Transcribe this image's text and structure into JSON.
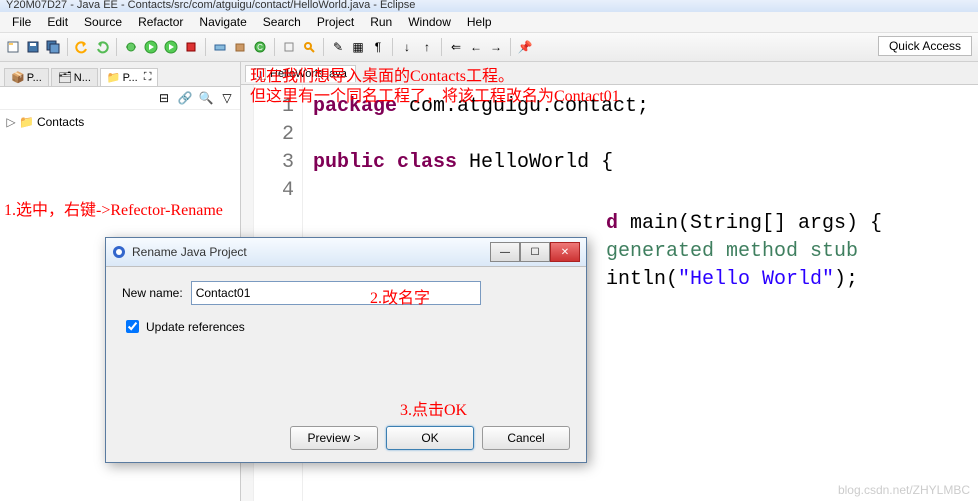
{
  "title": "Y20M07D27 - Java EE - Contacts/src/com/atguigu/contact/HelloWorld.java - Eclipse",
  "menu": [
    "File",
    "Edit",
    "Source",
    "Refactor",
    "Navigate",
    "Search",
    "Project",
    "Run",
    "Window",
    "Help"
  ],
  "quick_access": "Quick Access",
  "side": {
    "tabs": [
      {
        "icon": "pkg-explorer-icon",
        "label": "P..."
      },
      {
        "icon": "navigator-icon",
        "label": "N..."
      },
      {
        "icon": "project-explorer-icon",
        "label": "P..."
      }
    ],
    "project": "Contacts"
  },
  "editor": {
    "tab": "HelloWorld.java"
  },
  "code": {
    "lines": [
      "1",
      "2",
      "3",
      "4"
    ],
    "l1_kw": "package",
    "l1_rest": " com.atguigu.contact;",
    "l3_kw1": "public",
    "l3_kw2": "class",
    "l3_rest": " HelloWorld {",
    "peek1_kw": "d",
    "peek1_rest": " main(String[] args) {",
    "peek2_cm": "generated method stub",
    "peek3_a": "intln(",
    "peek3_str": "\"Hello World\"",
    "peek3_b": ");"
  },
  "annotations": {
    "top1": "现在我们想导入桌面的Contacts工程。",
    "top2": "但这里有一个同名工程了，将该工程改名为Contact01",
    "step1": "1.选中，右键->Refector-Rename",
    "step2": "2.改名字",
    "step3": "3.点击OK"
  },
  "dialog": {
    "title": "Rename Java Project",
    "new_name_label": "New name:",
    "new_name_value": "Contact01",
    "update_refs": "Update references",
    "preview": "Preview >",
    "ok": "OK",
    "cancel": "Cancel"
  },
  "watermark": "blog.csdn.net/ZHYLMBC"
}
